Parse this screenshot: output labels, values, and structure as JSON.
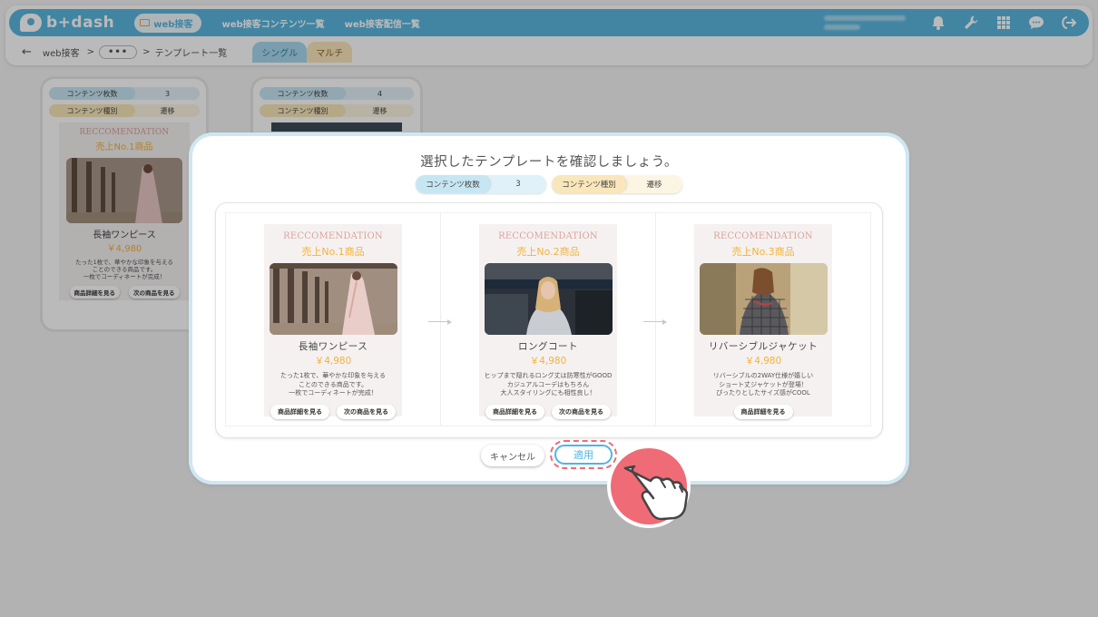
{
  "header": {
    "logo_text": "b+dash",
    "nav": [
      {
        "label": "web接客"
      },
      {
        "label": "web接客コンテンツ一覧"
      },
      {
        "label": "web接客配信一覧"
      }
    ],
    "icons": [
      "bell-icon",
      "wrench-icon",
      "grid-icon",
      "chat-icon",
      "logout-icon"
    ],
    "accent_color": "#5ab7e0"
  },
  "subbar": {
    "back": "←",
    "crumb_web": "web接客",
    "sep": ">",
    "ellipsis": "•••",
    "crumb_list": "テンプレート一覧",
    "tab_single": "シングル",
    "tab_multi": "マルチ"
  },
  "background_cards": [
    {
      "count_label": "コンテンツ枚数",
      "count": "3",
      "type_label": "コンテンツ種別",
      "type": "遷移"
    },
    {
      "count_label": "コンテンツ枚数",
      "count": "4",
      "type_label": "コンテンツ種別",
      "type": "遷移"
    }
  ],
  "bg_template": {
    "en": "RECCOMENDATION",
    "rank": "売上No.1商品",
    "name": "長袖ワンピース",
    "price": "￥4,980",
    "desc": [
      "たった1枚で、華やかな印象を与える",
      "ことのできる商品です。",
      "一枚でコーディネートが完成！"
    ],
    "btn_detail": "商品詳細を見る",
    "btn_next": "次の商品を見る"
  },
  "modal": {
    "title": "選択したテンプレートを確認しましょう。",
    "count_label": "コンテンツ枚数",
    "count": "3",
    "type_label": "コンテンツ種別",
    "type": "遷移",
    "slides": [
      {
        "en": "RECCOMENDATION",
        "rank": "売上No.1商品",
        "name": "長袖ワンピース",
        "price": "￥4,980",
        "desc": [
          "たった1枚で、華やかな印象を与える",
          "ことのできる商品です。",
          "一枚でコーディネートが完成！"
        ],
        "btn_detail": "商品詳細を見る",
        "btn_next": "次の商品を見る"
      },
      {
        "en": "RECCOMENDATION",
        "rank": "売上No.2商品",
        "name": "ロングコート",
        "price": "￥4,980",
        "desc": [
          "ヒップまで隠れるロング丈は防寒性がGOOD",
          "カジュアルコーデはもちろん",
          "大人スタイリングにも相性良し！"
        ],
        "btn_detail": "商品詳細を見る",
        "btn_next": "次の商品を見る"
      },
      {
        "en": "RECCOMENDATION",
        "rank": "売上No.3商品",
        "name": "リバーシブルジャケット",
        "price": "￥4,980",
        "desc": [
          "リバーシブルの2WAY仕様が嬉しい",
          "ショート丈ジャケットが登場！",
          "ぴったりとしたサイズ感がCOOL"
        ],
        "btn_detail": "商品詳細を見る"
      }
    ],
    "cancel": "キャンセル",
    "apply": "適用"
  }
}
